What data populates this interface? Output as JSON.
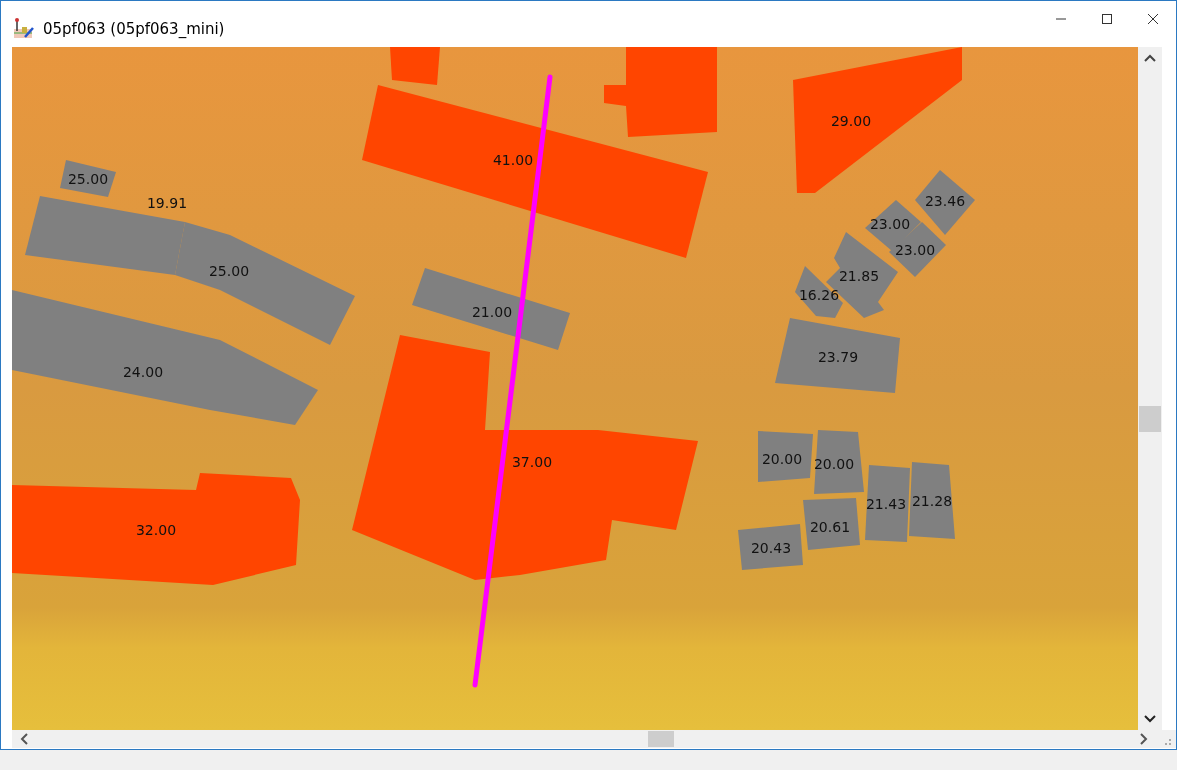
{
  "window": {
    "title": "05pf063 (05pf063_mini)"
  },
  "map": {
    "buildings": [
      {
        "kind": "tall"
      },
      {
        "kind": "tall"
      },
      {
        "kind": "tall",
        "label": "41.00"
      },
      {
        "kind": "tall",
        "label": "29.00"
      },
      {
        "kind": "tall",
        "label": "37.00"
      },
      {
        "kind": "tall",
        "label": "32.00"
      },
      {
        "kind": "low",
        "label": "25.00"
      },
      {
        "kind": "low",
        "label": "19.91"
      },
      {
        "kind": "low",
        "label": "25.00"
      },
      {
        "kind": "low",
        "label": "24.00"
      },
      {
        "kind": "low",
        "label": "21.00"
      },
      {
        "kind": "low",
        "label": "23.46"
      },
      {
        "kind": "low",
        "label": "23.00"
      },
      {
        "kind": "low",
        "label": "23.00"
      },
      {
        "kind": "low",
        "label": "21.85"
      },
      {
        "kind": "low",
        "label": "16.26"
      },
      {
        "kind": "low",
        "label": "23.79"
      },
      {
        "kind": "low",
        "label": "20.00"
      },
      {
        "kind": "low",
        "label": "20.00"
      },
      {
        "kind": "low",
        "label": "21.43"
      },
      {
        "kind": "low",
        "label": "21.28"
      },
      {
        "kind": "low",
        "label": "20.61"
      },
      {
        "kind": "low",
        "label": "20.43"
      }
    ]
  }
}
